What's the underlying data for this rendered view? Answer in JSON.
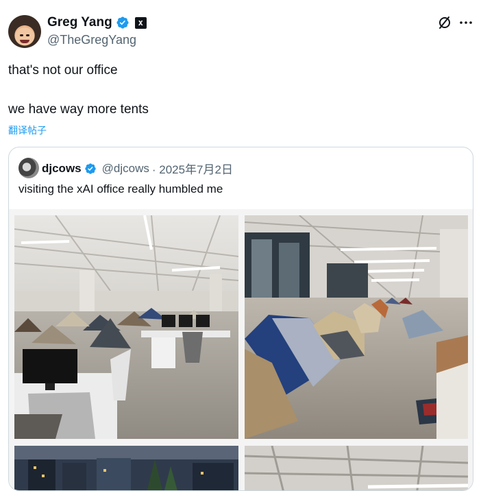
{
  "tweet": {
    "author_name": "Greg Yang",
    "author_handle": "@TheGregYang",
    "line1": "that's not our office",
    "line2": "we have way more tents",
    "translate_label": "翻译帖子",
    "affiliate_badge_text": "x"
  },
  "quote": {
    "author_name": "djcows",
    "author_handle": "@djcows",
    "date": "· 2025年7月2日",
    "text": "visiting the xAI office really humbled me"
  },
  "colors": {
    "link": "#1d9bf0",
    "verified": "#1d9bf0",
    "muted": "#536471",
    "border": "#cfd9de"
  },
  "icons": [
    "verified-badge-icon",
    "xai-affiliate-icon",
    "grok-icon",
    "more-icon"
  ]
}
